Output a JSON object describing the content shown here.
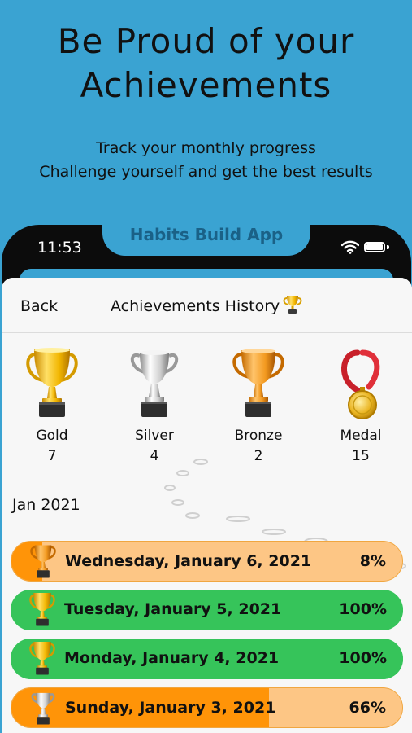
{
  "promo": {
    "title_line1": "Be Proud of your",
    "title_line2": "Achievements",
    "subtitle_line1": "Track your monthly progress",
    "subtitle_line2": "Challenge yourself and get the best results",
    "app_label": "Habits Build App"
  },
  "status_bar": {
    "time": "11:53",
    "icons": [
      "wifi-icon",
      "battery-icon"
    ]
  },
  "nav": {
    "back_label": "Back",
    "title": "Achievements History",
    "title_icon": "trophy-icon"
  },
  "awards": [
    {
      "name": "Gold",
      "count": "7",
      "icon": "gold-trophy-icon"
    },
    {
      "name": "Silver",
      "count": "4",
      "icon": "silver-trophy-icon"
    },
    {
      "name": "Bronze",
      "count": "2",
      "icon": "bronze-trophy-icon"
    },
    {
      "name": "Medal",
      "count": "15",
      "icon": "medal-icon"
    }
  ],
  "month": "Jan 2021",
  "days": [
    {
      "date": "Wednesday, January 6, 2021",
      "percent_label": "8%",
      "progress": 0.08,
      "icon": "bronze-trophy-icon"
    },
    {
      "date": "Tuesday, January 5, 2021",
      "percent_label": "100%",
      "progress": 1.0,
      "icon": "gold-trophy-icon"
    },
    {
      "date": "Monday, January 4, 2021",
      "percent_label": "100%",
      "progress": 1.0,
      "icon": "gold-trophy-icon"
    },
    {
      "date": "Sunday, January 3, 2021",
      "percent_label": "66%",
      "progress": 0.66,
      "icon": "silver-trophy-icon"
    }
  ],
  "colors": {
    "background": "#3aa3d2",
    "complete_row": "#36c45a",
    "partial_fill": "#ff9408",
    "partial_track": "#fdc685"
  }
}
